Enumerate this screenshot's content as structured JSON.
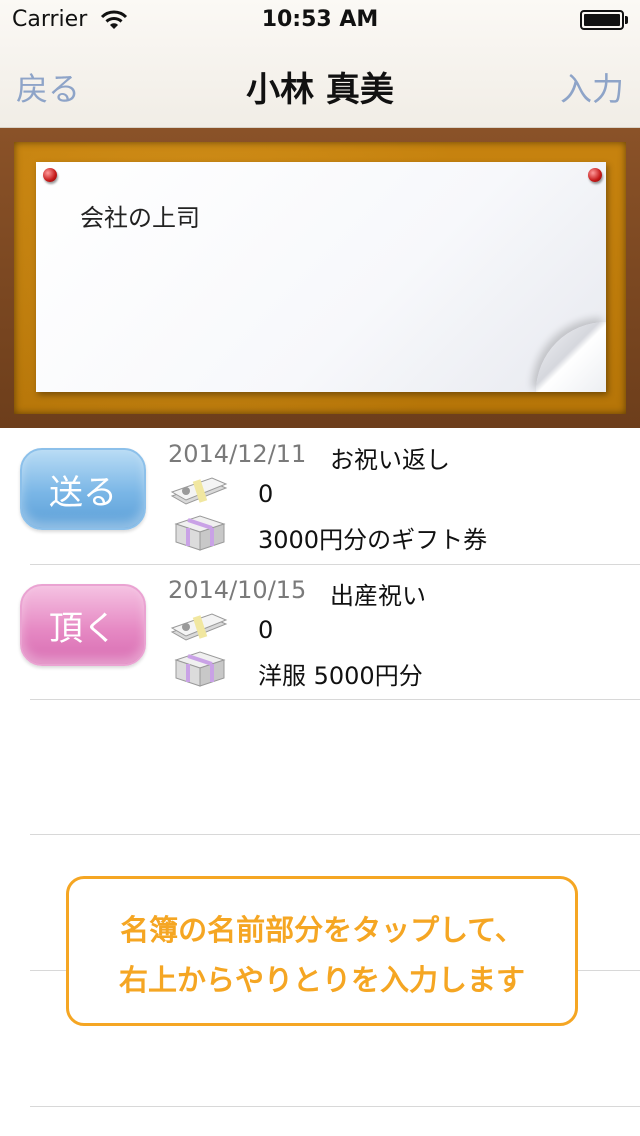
{
  "status_bar": {
    "carrier": "Carrier",
    "time": "10:53 AM"
  },
  "nav": {
    "back_label": "戻る",
    "title": "小林 真美",
    "input_label": "入力"
  },
  "note": {
    "text": "会社の上司"
  },
  "entries": [
    {
      "type_label": "送る",
      "date": "2014/12/11",
      "title": "お祝い返し",
      "money": "0",
      "gift": "3000円分のギフト券",
      "kind": "send"
    },
    {
      "type_label": "頂く",
      "date": "2014/10/15",
      "title": "出産祝い",
      "money": "0",
      "gift": "洋服 5000円分",
      "kind": "receive"
    }
  ],
  "hint": {
    "line1": "名簿の名前部分をタップして、",
    "line2": "右上からやりとりを入力します"
  },
  "colors": {
    "accent": "#f5a623",
    "nav_button": "#8ea4c8",
    "send": "#7ab6e6",
    "receive": "#e68ac4"
  }
}
